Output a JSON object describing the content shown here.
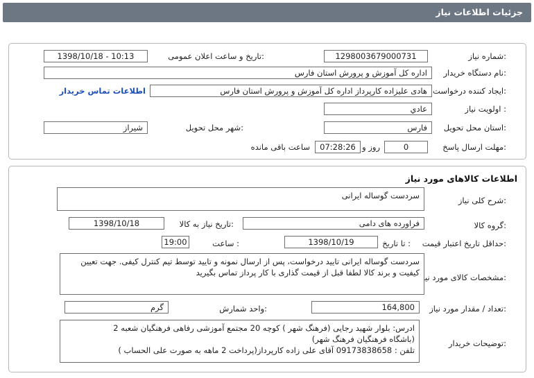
{
  "window": {
    "title": "جزئیات اطلاعات نیاز"
  },
  "details": {
    "need_number_label": "شماره نیاز:",
    "need_number": "1298003679000731",
    "announce_label": "تاریخ و ساعت اعلان عمومی:",
    "announce_value": "1398/10/18 - 10:13",
    "buyer_org_label": "نام دستگاه خریدار:",
    "buyer_org": "اداره کل آموزش و پرورش استان فارس",
    "requester_label": "ایجاد کننده درخواست:",
    "requester": "هادی علیزاده کارپرداز اداره کل آموزش و پرورش استان فارس",
    "contact_link": "اطلاعات تماس خریدار",
    "priority_label": "اولویت نیاز :",
    "priority": "عادي",
    "province_label": "استان محل تحویل:",
    "province": "فارس",
    "city_label": "شهر محل تحویل:",
    "city": "شیراز",
    "deadline_label": "مهلت ارسال پاسخ:",
    "deadline_days": "0",
    "deadline_days_suffix": "روز و",
    "deadline_time": "07:28:26",
    "deadline_remaining": "ساعت باقی مانده"
  },
  "goods": {
    "section_title": "اطلاعات کالاهای مورد نیاز",
    "summary_label": "شرح کلی نیاز:",
    "summary": "سردست گوساله ایرانی",
    "group_label": "گروه کالا:",
    "group": "فراورده های دامی",
    "need_date_label": "تاریخ نیاز به کالا:",
    "need_date": "1398/10/18",
    "validity_label": "حداقل تاریخ اعتبار قیمت:",
    "until_date_label": "تا تاریخ :",
    "until_date": "1398/10/19",
    "time_label": "ساعت :",
    "time": "19:00",
    "specs_label": "مشخصات کالای مورد نیاز:",
    "specs": "سردست گوساله ایرانی تایید درخواست، پس از ارسال نمونه و تایید توسط تیم کنترل کیفی. جهت تعیین کیفیت و برند کالا لطفا قبل از قیمت گذاری با کار پرداز تماس بگیرید",
    "quantity_label": "تعداد / مقدار مورد نیاز:",
    "quantity": "164,800",
    "unit_label": "واحد شمارش:",
    "unit": "گرم",
    "buyer_notes_label": "توضیحات خریدار:",
    "buyer_notes": [
      "ادرس: بلوار شهید رجایی (فرهنگ شهر ) کوچه 20  مجتمع آموزشی رفاهی فرهنگیان شعبه 2",
      "(باشگاه فرهنگیان فرهنگ شهر)",
      "تلفن : 09173838658 آقای علی زاده کارپرداز(پرداخت 2 ماهه به صورت علی الحساب )"
    ]
  }
}
